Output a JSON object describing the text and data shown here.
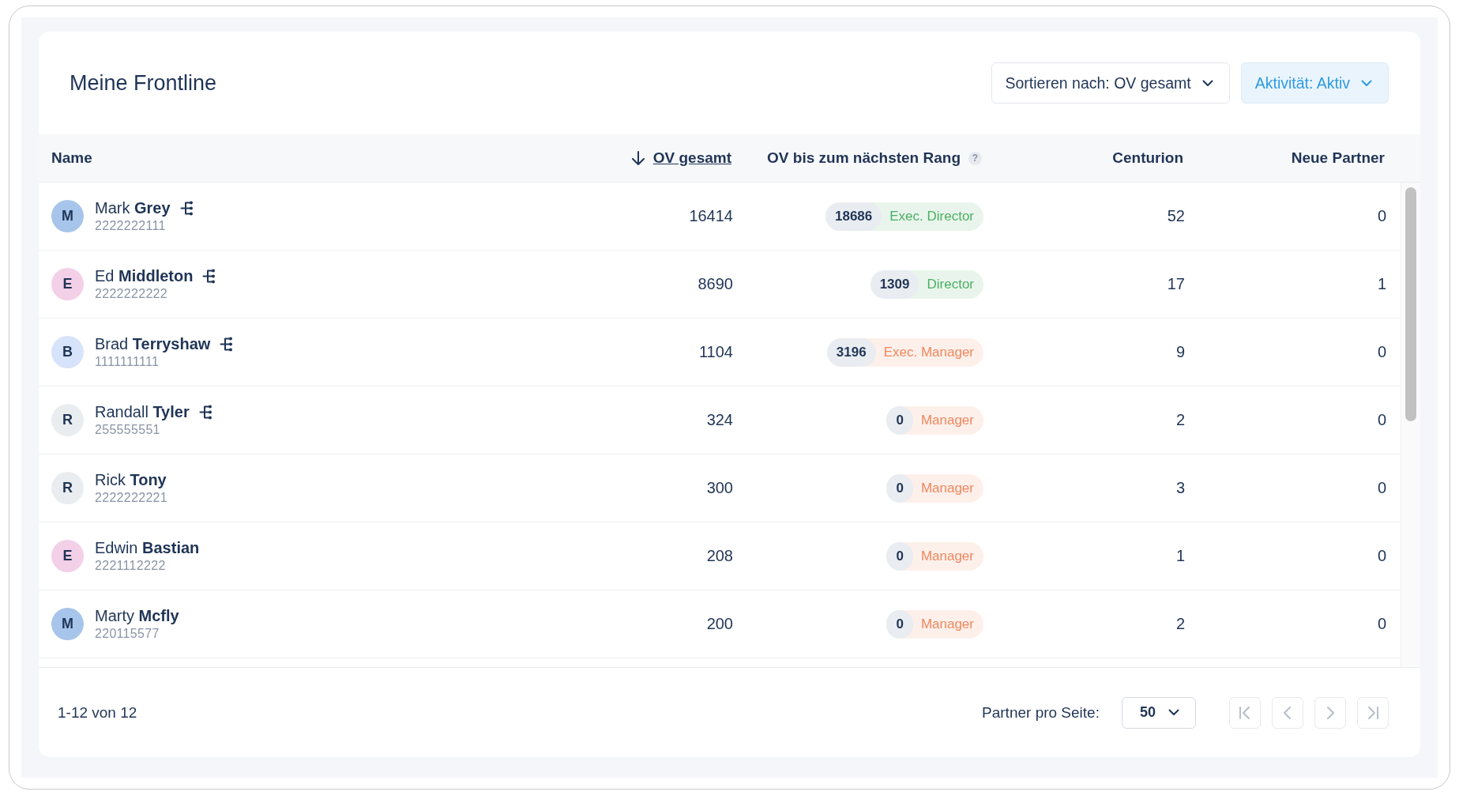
{
  "title": "Meine Frontline",
  "filters": [
    {
      "label": "Sortieren nach: OV gesamt",
      "active": false
    },
    {
      "label": "Aktivität: Aktiv",
      "active": true
    }
  ],
  "table": {
    "columns": [
      {
        "label": "Name",
        "sorted": false
      },
      {
        "label": "OV gesamt",
        "sorted": true
      },
      {
        "label": "OV bis zum nächsten Rang",
        "sorted": false,
        "help": "?"
      },
      {
        "label": "Centurion",
        "sorted": false
      },
      {
        "label": "Neue Partner",
        "sorted": false
      }
    ],
    "rows": [
      {
        "initial": "M",
        "color": "#a7c5ea",
        "name": "Mark **Grey**",
        "has_downline": true,
        "id": "2222222111",
        "ov": "16414",
        "badge": {
          "value": "18686",
          "rank": "Exec. Director",
          "color": "#4caf64"
        },
        "centurion": "52",
        "new_partners": "0"
      },
      {
        "initial": "E",
        "color": "#f3cfe8",
        "name": "Ed **Middleton**",
        "has_downline": true,
        "id": "2222222222",
        "ov": "8690",
        "badge": {
          "value": "1309",
          "rank": "Director",
          "color": "#4caf64"
        },
        "centurion": "17",
        "new_partners": "1"
      },
      {
        "initial": "B",
        "color": "#d7e3fa",
        "name": "Brad **Terryshaw**",
        "has_downline": true,
        "id": "1111111111",
        "ov": "1104",
        "badge": {
          "value": "3196",
          "rank": "Exec. Manager",
          "color": "#f0875e"
        },
        "centurion": "9",
        "new_partners": "0"
      },
      {
        "initial": "R",
        "color": "#eaedf0",
        "name": "Randall **Tyler**",
        "has_downline": true,
        "id": "255555551",
        "ov": "324",
        "badge": {
          "value": "0",
          "rank": "Manager",
          "color": "#f0875e"
        },
        "centurion": "2",
        "new_partners": "0"
      },
      {
        "initial": "R",
        "color": "#eaedf0",
        "name": "Rick **Tony**",
        "has_downline": false,
        "id": "2222222221",
        "ov": "300",
        "badge": {
          "value": "0",
          "rank": "Manager",
          "color": "#f0875e"
        },
        "centurion": "3",
        "new_partners": "0"
      },
      {
        "initial": "E",
        "color": "#f3cfe8",
        "name": "Edwin **Bastian**",
        "has_downline": false,
        "id": "2221112222",
        "ov": "208",
        "badge": {
          "value": "0",
          "rank": "Manager",
          "color": "#f0875e"
        },
        "centurion": "1",
        "new_partners": "0"
      },
      {
        "initial": "M",
        "color": "#a7c5ea",
        "name": "Marty **Mcfly**",
        "has_downline": false,
        "id": "220115577",
        "ov": "200",
        "badge": {
          "value": "0",
          "rank": "Manager",
          "color": "#f0875e"
        },
        "centurion": "2",
        "new_partners": "0"
      }
    ]
  },
  "footer": {
    "range": "1-12 von 12",
    "per_page_label": "Partner pro Seite:",
    "per_page": "50",
    "pager": [
      {
        "kind": "first",
        "disabled": true
      },
      {
        "kind": "prev",
        "disabled": true
      },
      {
        "kind": "next",
        "disabled": true
      },
      {
        "kind": "last",
        "disabled": true
      }
    ]
  }
}
